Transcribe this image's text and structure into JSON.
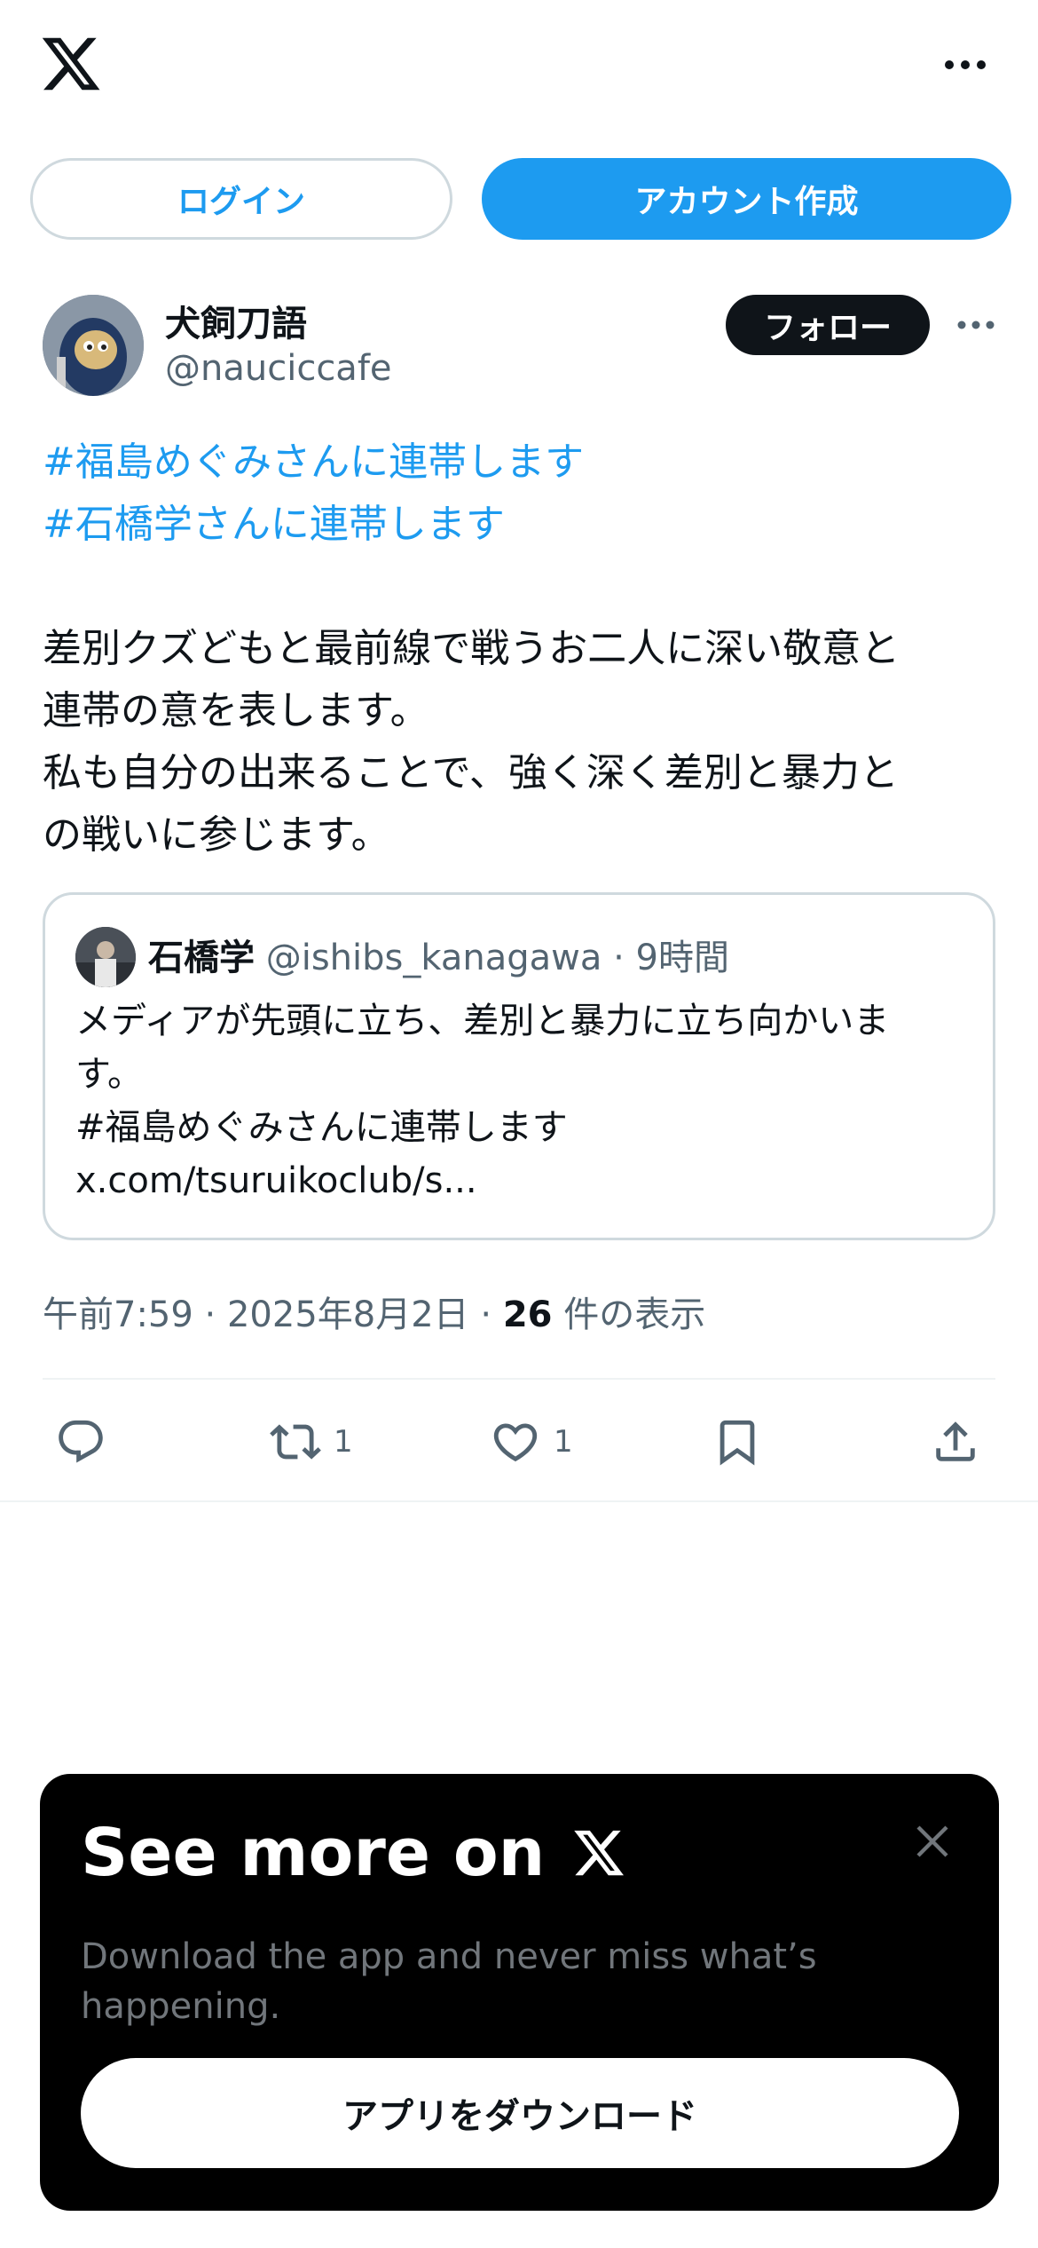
{
  "header": {
    "logo_icon": "x-logo-icon",
    "more_icon": "more-horizontal-icon"
  },
  "auth": {
    "login_label": "ログイン",
    "signup_label": "アカウント作成"
  },
  "tweet": {
    "author_name": "犬飼刀語",
    "author_handle": "@nauciccafe",
    "follow_label": "フォロー",
    "hashtags": [
      "#福島めぐみさんに連帯します",
      "#石橋学さんに連帯します"
    ],
    "body_lines": [
      "差別クズどもと最前線で戦うお二人に深い敬意と",
      "連帯の意を表します。",
      "私も自分の出来ることで、強く深く差別と暴力と",
      "の戦いに参じます。"
    ],
    "quote": {
      "name": "石橋学",
      "handle": "@ishibs_kanagawa",
      "time": "· 9時間",
      "lines": [
        "メディアが先頭に立ち、差別と暴力に立ち向かいま",
        "す。",
        "#福島めぐみさんに連帯します",
        "x.com/tsuruikoclub/s..."
      ]
    },
    "meta": {
      "time": "午前7:59 · 2025年8月2日 · ",
      "views_count": "26",
      "views_label": " 件の表示"
    },
    "actions": {
      "reply_count": "",
      "retweet_count": "1",
      "like_count": "1"
    }
  },
  "promo": {
    "title": "See more on",
    "subtitle": "Download the app and never miss what’s happening.",
    "download_label": "アプリをダウンロード"
  },
  "colors": {
    "accent": "#1d9bf0",
    "text": "#0f1419",
    "secondary": "#536471",
    "border": "#cfd9de"
  }
}
